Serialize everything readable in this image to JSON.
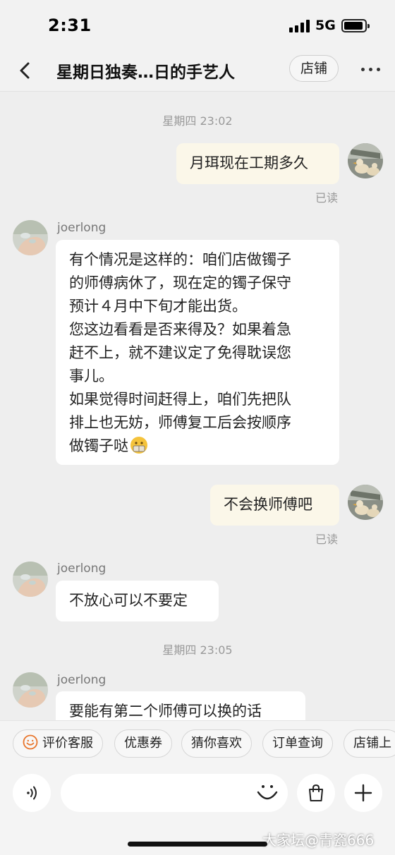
{
  "status_bar": {
    "time": "2:31",
    "network": "5G"
  },
  "nav": {
    "title": "星期日独奏…日的手艺人",
    "store_label": "店铺"
  },
  "chat": {
    "timestamps": [
      "星期四 23:02",
      "星期四 23:05"
    ],
    "read_label": "已读",
    "sender_name": "joerlong",
    "messages": [
      {
        "from": "me",
        "text": "月珥现在工期多久"
      },
      {
        "from": "shop",
        "lines": [
          "有个情况是这样的：咱们店做镯子",
          "的师傅病休了，现在定的镯子保守",
          "预计４月中下旬才能出货。",
          "您这边看看是否来得及？如果着急",
          "赶不上，就不建议定了免得耽误您",
          "事儿。",
          "如果觉得时间赶得上，咱们先把队",
          "排上也无妨，师傅复工后会按顺序",
          "做镯子哒"
        ],
        "emoji": "money-mouth-emoji"
      },
      {
        "from": "me",
        "text": "不会换师傅吧"
      },
      {
        "from": "shop",
        "text": "不放心可以不要定"
      },
      {
        "from": "shop",
        "text": "要能有第二个师傅可以换的话"
      }
    ]
  },
  "quick_replies": [
    "评价客服",
    "优惠券",
    "猜你喜欢",
    "订单查询",
    "店铺上"
  ],
  "input": {
    "placeholder": ""
  },
  "watermark": "大家坛@青瓷666",
  "colors": {
    "my_bubble": "#fbf7e9",
    "their_bubble": "#ffffff",
    "background": "#eeeeee",
    "chip_icon": "#e8742a"
  },
  "icons": [
    "back-arrow-icon",
    "more-icon",
    "voice-icon",
    "emoji-icon",
    "shopping-bag-icon",
    "plus-icon",
    "smiley-icon"
  ]
}
